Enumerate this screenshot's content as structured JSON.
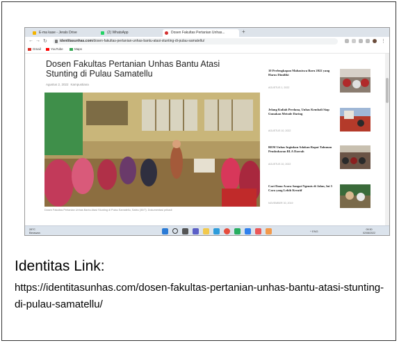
{
  "browser": {
    "tabs": [
      {
        "label": "E-ma kase - Jerals Drive"
      },
      {
        "label": "(2) WhatsApp"
      },
      {
        "label": "Dosen Fakultas Pertanian Unhas..."
      }
    ],
    "new_tab_label": "+",
    "url_host": "identitasunhas.com",
    "url_path": "/dosen-fakultas-pertanian-unhas-bantu-atasi-stunting-di-pulau-samatellu/",
    "bookmarks": [
      {
        "label": "Gmail",
        "color": "#d93025"
      },
      {
        "label": "YouTube",
        "color": "#ff0000"
      },
      {
        "label": "Maps",
        "color": "#34a853"
      }
    ]
  },
  "article": {
    "title": "Dosen Fakultas Pertanian Unhas Bantu Atasi Stunting di Pulau Samatellu",
    "date": "Agustus 2, 2022",
    "category": "Kampustiana",
    "caption": "Dosen Fakultas Pertanian Unhas Bantu Atasi Stunting di Pulau Samatellu, Sabtu (30/7). Dokumentasi pribadi"
  },
  "sidebar": [
    {
      "title": "10 Perlengkapan Mahasiswa Baru 2022 yang Harus Dimiliki",
      "meta": "AGUSTUS 1, 2022"
    },
    {
      "title": "Jelang Kuliah Perdana, Unhas Kembali Siap Gunakan Metode Daring",
      "meta": "AGUSTUS 10, 2022"
    },
    {
      "title": "BEM Unhas Inginkan Adakan Rapat Tahunan Pembubaran BLA Daerah",
      "meta": "AGUSTUS 10, 2022"
    },
    {
      "title": "Cari Dana Acara Sangat Ngemis di Jalan, Ini 5 Cara yang Lebih Kreatif",
      "meta": "NOVEMBER 30, 2019"
    }
  ],
  "taskbar": {
    "weather_temp": "28°C",
    "weather_desc": "Berawan",
    "tray": "^ ENG",
    "time": "09:30",
    "date": "02/08/2022"
  },
  "footer": {
    "heading": "Identitas Link:",
    "link": "https://identitasunhas.com/dosen-fakultas-pertanian-unhas-bantu-atasi-stunting-di-pulau-samatellu/"
  }
}
